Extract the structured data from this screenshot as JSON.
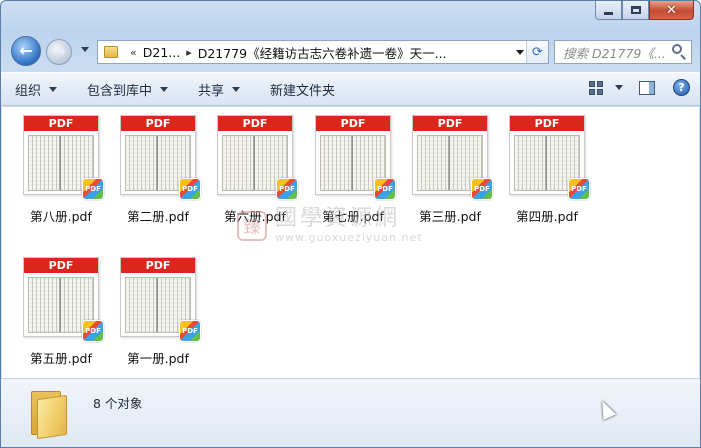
{
  "window": {
    "caption_buttons": {
      "minimize_icon": "minimize-icon",
      "maximize_icon": "maximize-icon",
      "close_glyph": "✕"
    }
  },
  "nav": {
    "back_glyph": "←",
    "forward_glyph": "→",
    "breadcrumb_overflow": "«",
    "crumb_short": "D21...",
    "crumb_sep": "▸",
    "crumb_current": "D21779《经籍访古志六卷补遗一卷》天一...",
    "refresh_glyph": "⟳",
    "search_placeholder": "搜索 D21779《..."
  },
  "toolbar": {
    "organize": "组织",
    "include_in_library": "包含到库中",
    "share": "共享",
    "new_folder": "新建文件夹",
    "help_glyph": "?"
  },
  "files": [
    {
      "name": "第八册.pdf",
      "band": "PDF"
    },
    {
      "name": "第二册.pdf",
      "band": "PDF"
    },
    {
      "name": "第六册.pdf",
      "band": "PDF"
    },
    {
      "name": "第七册.pdf",
      "band": "PDF"
    },
    {
      "name": "第三册.pdf",
      "band": "PDF"
    },
    {
      "name": "第四册.pdf",
      "band": "PDF"
    },
    {
      "name": "第五册.pdf",
      "band": "PDF"
    },
    {
      "name": "第一册.pdf",
      "band": "PDF"
    }
  ],
  "badge_text": "PDF",
  "watermark": {
    "seal": "臻",
    "text": "國學資源網",
    "url": "www.guoxueziyuan.net"
  },
  "status": {
    "object_count": "8 个对象"
  },
  "colors": {
    "pdf_band": "#d9271e",
    "window_frame": "#bcd3ee"
  }
}
